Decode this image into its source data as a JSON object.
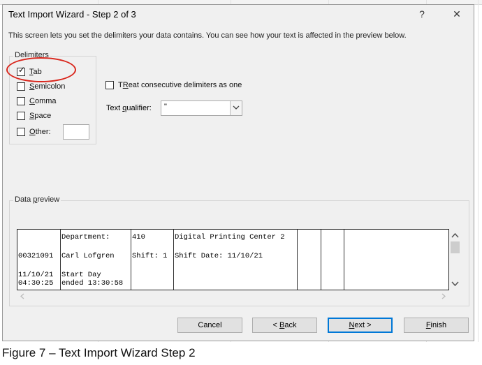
{
  "dialog": {
    "title": "Text Import Wizard - Step 2 of 3",
    "help_label": "?",
    "close_label": "✕",
    "instructions": "This screen lets you set the delimiters your data contains.  You can see how your text is affected in the preview below."
  },
  "delimiters": {
    "legend": "Delimiters",
    "options": [
      {
        "key": "T",
        "rest": "ab",
        "checked": true
      },
      {
        "key": "S",
        "rest": "emicolon",
        "checked": false
      },
      {
        "key": "C",
        "rest": "omma",
        "checked": false
      },
      {
        "key": "S",
        "rest": "pace",
        "checked": false
      },
      {
        "key": "O",
        "rest": "ther:",
        "checked": false
      }
    ],
    "other_value": ""
  },
  "consecutive": {
    "key": "R",
    "pre": "T",
    "rest": "eat consecutive delimiters as one",
    "checked": false
  },
  "qualifier": {
    "pre": "Text ",
    "key": "q",
    "rest": "ualifier:",
    "value": "\""
  },
  "preview": {
    "legend_pre": "Data ",
    "legend_key": "p",
    "legend_rest": "review",
    "cells": [
      {
        "text": "Department:",
        "col": 1,
        "row": 0
      },
      {
        "text": "410",
        "col": 2,
        "row": 0
      },
      {
        "text": "Digital Printing Center 2",
        "col": 3,
        "row": 0
      },
      {
        "text": "00321091",
        "col": 0,
        "row": 2
      },
      {
        "text": "Carl Lofgren",
        "col": 1,
        "row": 2
      },
      {
        "text": "Shift: 1",
        "col": 2,
        "row": 2
      },
      {
        "text": "Shift Date: 11/10/21",
        "col": 3,
        "row": 2
      },
      {
        "text": "11/10/21",
        "col": 0,
        "row": 4
      },
      {
        "text": "Start Day",
        "col": 1,
        "row": 4
      },
      {
        "text": "04:30:25",
        "col": 0,
        "row": 5
      },
      {
        "text": "ended 13:30:58",
        "col": 1,
        "row": 5
      }
    ]
  },
  "buttons": {
    "cancel": "Cancel",
    "back_arrow": "< ",
    "back_key": "B",
    "back_rest": "ack",
    "next_key": "N",
    "next_rest": "ext >",
    "finish_key": "F",
    "finish_rest": "inish"
  },
  "caption": "Figure 7 – Text Import Wizard Step 2",
  "colors": {
    "highlight_circle": "#d9261c",
    "default_button_border": "#0078d7"
  }
}
